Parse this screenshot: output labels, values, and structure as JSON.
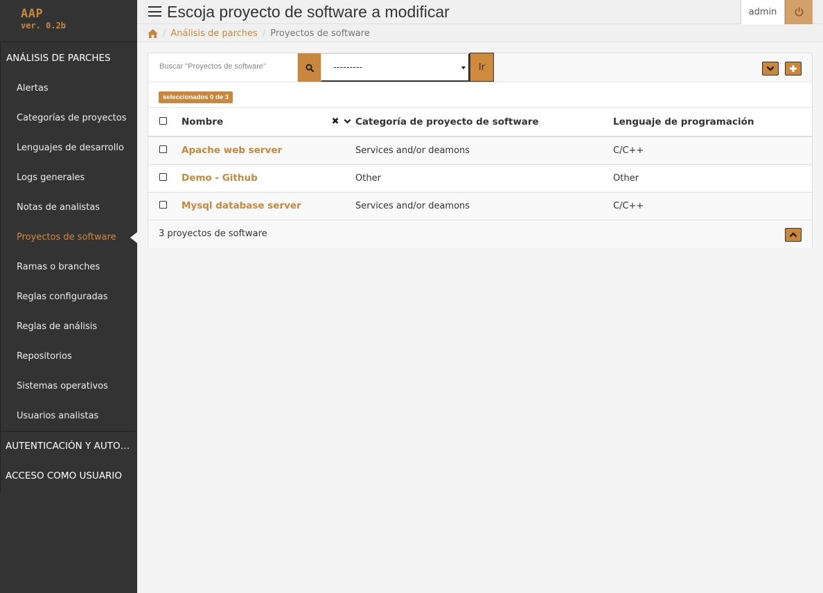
{
  "brand": {
    "name": "AAP",
    "version": "ver. 0.2b"
  },
  "colors": {
    "accent": "#c8873c",
    "sidebar": "#333333",
    "power": "#d4a06a"
  },
  "header": {
    "title": "Escoja proyecto de software a modificar",
    "user": "admin",
    "menu_icon": "hamburger-icon",
    "power_icon": "power-icon"
  },
  "breadcrumb": {
    "home_icon": "home-icon",
    "section": "Análisis de parches",
    "current": "Proyectos de software"
  },
  "sidebar": {
    "section_open": "ANÁLISIS DE PARCHES",
    "items": [
      {
        "label": "Alertas"
      },
      {
        "label": "Categorías de proyectos"
      },
      {
        "label": "Lenguajes de desarrollo"
      },
      {
        "label": "Logs generales"
      },
      {
        "label": "Notas de analistas"
      },
      {
        "label": "Proyectos de software",
        "active": true
      },
      {
        "label": "Ramas o branches"
      },
      {
        "label": "Reglas configuradas"
      },
      {
        "label": "Reglas de análisis"
      },
      {
        "label": "Repositorios"
      },
      {
        "label": "Sistemas operativos"
      },
      {
        "label": "Usuarios analistas"
      }
    ],
    "section_auth": "AUTENTICACIÓN Y AUTORIZACIÓN",
    "section_access": "ACCESO COMO USUARIO"
  },
  "toolbar": {
    "search_placeholder": "Buscar \"Proyectos de software\"",
    "action_select": "---------",
    "go_label": "Ir"
  },
  "selection": {
    "badge": "seleccionados 0 de 3"
  },
  "table": {
    "columns": {
      "name": "Nombre",
      "category": "Categoría de proyecto de software",
      "language": "Lenguaje de programación"
    },
    "sort_icons": "✖ ❯",
    "rows": [
      {
        "name": "Apache web server",
        "category": "Services and/or deamons",
        "language": "C/C++"
      },
      {
        "name": "Demo - Github",
        "category": "Other",
        "language": "Other"
      },
      {
        "name": "Mysql database server",
        "category": "Services and/or deamons",
        "language": "C/C++"
      }
    ]
  },
  "footer": {
    "count_text": "3 proyectos de software"
  }
}
